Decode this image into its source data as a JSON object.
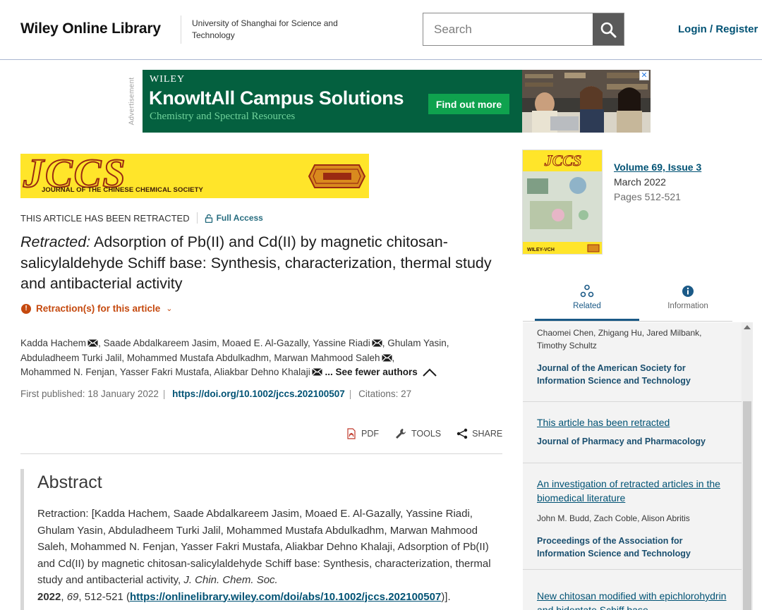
{
  "header": {
    "logo": "Wiley Online Library",
    "institution": "University of Shanghai for Science and Technology",
    "search_placeholder": "Search",
    "login": "Login / Register"
  },
  "ad": {
    "label": "Advertisement",
    "brand": "WILEY",
    "title": "KnowItAll Campus Solutions",
    "subtitle": "Chemistry and Spectral Resources",
    "cta": "Find out more",
    "close": "✕"
  },
  "journal_banner": {
    "big": "JCCS",
    "name": "JOURNAL OF THE CHINESE CHEMICAL SOCIETY"
  },
  "article": {
    "retracted_label": "THIS ARTICLE HAS BEEN RETRACTED",
    "access": "Full Access",
    "title_prefix": "Retracted:",
    "title": " Adsorption of Pb(II) and Cd(II) by magnetic chitosan-salicylaldehyde Schiff base: Synthesis, characterization, thermal study and antibacterial activity",
    "retraction_link": "Retraction(s) for this article",
    "authors_line1": "Kadda Hachem",
    "authors_line1b": ", Saade Abdalkareem Jasim, Moaed E. Al-Gazally, Yassine Riadi",
    "authors_line1c": ", Ghulam Yasin,",
    "authors_line2": "Abduladheem Turki Jalil, Mohammed Mustafa Abdulkadhm, Marwan Mahmood Saleh",
    "authors_line2b": ",",
    "authors_line3": "Mohammed N. Fenjan, Yasser Fakri Mustafa, Aliakbar Dehno Khalaji",
    "see_fewer": " ... See fewer authors",
    "first_published_label": "First published: 18 January 2022",
    "doi": "https://doi.org/10.1002/jccs.202100507",
    "citations": "Citations: 27",
    "tools": {
      "pdf": "PDF",
      "tools": "TOOLS",
      "share": "SHARE"
    },
    "abstract_heading": "Abstract",
    "abstract_text": "Retraction: [Kadda Hachem, Saade Abdalkareem Jasim, Moaed E. Al-Gazally, Yassine Riadi, Ghulam Yasin, Abduladheem Turki Jalil, Mohammed Mustafa Abdulkadhm, Marwan Mahmood Saleh, Mohammed N. Fenjan, Yasser Fakri Mustafa, Aliakbar Dehno Khalaji, Adsorption of Pb(II) and Cd(II) by magnetic chitosan-salicylaldehyde Schiff base: Synthesis, characterization, thermal study and antibacterial activity, ",
    "abstract_journal": "J. Chin. Chem. Soc.",
    "abstract_year": "2022",
    "abstract_vol": "69",
    "abstract_pages": ", 512-521 (",
    "abstract_link": "https://onlinelibrary.wiley.com/doi/abs/10.1002/jccs.202100507",
    "abstract_end": ")]."
  },
  "issue": {
    "volume": "Volume 69, Issue 3",
    "date": "March 2022",
    "pages": "Pages 512-521"
  },
  "sidebar_tabs": [
    {
      "label": "Related",
      "icon": "related-icon"
    },
    {
      "label": "Information",
      "icon": "info-icon"
    }
  ],
  "related": [
    {
      "authors": "Chaomei Chen, Zhigang Hu, Jared Milbank, Timothy Schultz",
      "journal": "Journal of the American Society for Information Science and Technology"
    },
    {
      "title": "This article has been retracted",
      "journal": "Journal of Pharmacy and Pharmacology"
    },
    {
      "title": "An investigation of retracted articles in the biomedical literature",
      "authors": "John M. Budd, Zach Coble, Alison Abritis",
      "journal": "Proceedings of the Association for Information Science and Technology"
    },
    {
      "title": "New chitosan modified with epichlorohydrin and bidentate Schiff base"
    }
  ],
  "colors": {
    "link": "#005274",
    "retraction": "#c5490e",
    "ad_bg": "#04603f",
    "banner_yellow": "#ffe52a"
  }
}
